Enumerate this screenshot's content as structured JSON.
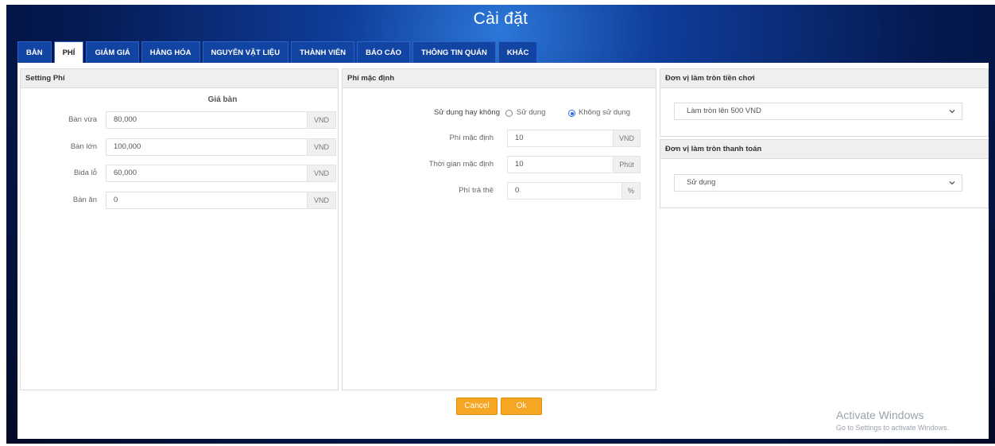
{
  "window": {
    "title": "Cài đặt"
  },
  "tabs": [
    "BÀN",
    "PHÍ",
    "GIẢM GIÁ",
    "HÀNG HÓA",
    "NGUYÊN VẬT LIỆU",
    "THÀNH VIÊN",
    "BÁO CÁO",
    "THÔNG TIN QUÁN",
    "KHÁC"
  ],
  "active_tab": "PHÍ",
  "setting_phi": {
    "title": "Setting Phí",
    "column_header": "Giá bàn",
    "rows": [
      {
        "label": "Bàn vừa",
        "value": "80,000",
        "unit": "VND"
      },
      {
        "label": "Bàn lớn",
        "value": "100,000",
        "unit": "VND"
      },
      {
        "label": "Bida lỗ",
        "value": "60,000",
        "unit": "VND"
      },
      {
        "label": "Bàn ăn",
        "value": "0",
        "unit": "VND"
      }
    ]
  },
  "phi_mac_dinh": {
    "title": "Phí mặc định",
    "use_label": "Sử dụng hay không",
    "option_use": "Sử dụng",
    "option_not_use": "Không sử dụng",
    "selected": "Không sử dụng",
    "fields": [
      {
        "label": "Phí mặc định",
        "value": "10",
        "unit": "VND"
      },
      {
        "label": "Thời gian mặc định",
        "value": "10",
        "unit": "Phút"
      },
      {
        "label": "Phí trả thẻ",
        "value": "0",
        "unit": "%"
      }
    ]
  },
  "rounding_play": {
    "title": "Đơn vị làm tròn tiền chơi",
    "selected": "Làm tròn lên 500 VND"
  },
  "rounding_payment": {
    "title": "Đơn vị làm tròn thanh toán",
    "selected": "Sử dụng"
  },
  "buttons": {
    "cancel": "Cancel",
    "ok": "Ok"
  },
  "watermark": {
    "line1": "Activate Windows",
    "line2": "Go to Settings to activate Windows."
  },
  "colors": {
    "accent_button": "#f5a623",
    "radio_selected": "#2a6fdb",
    "tab_bg": "#1244a4"
  }
}
